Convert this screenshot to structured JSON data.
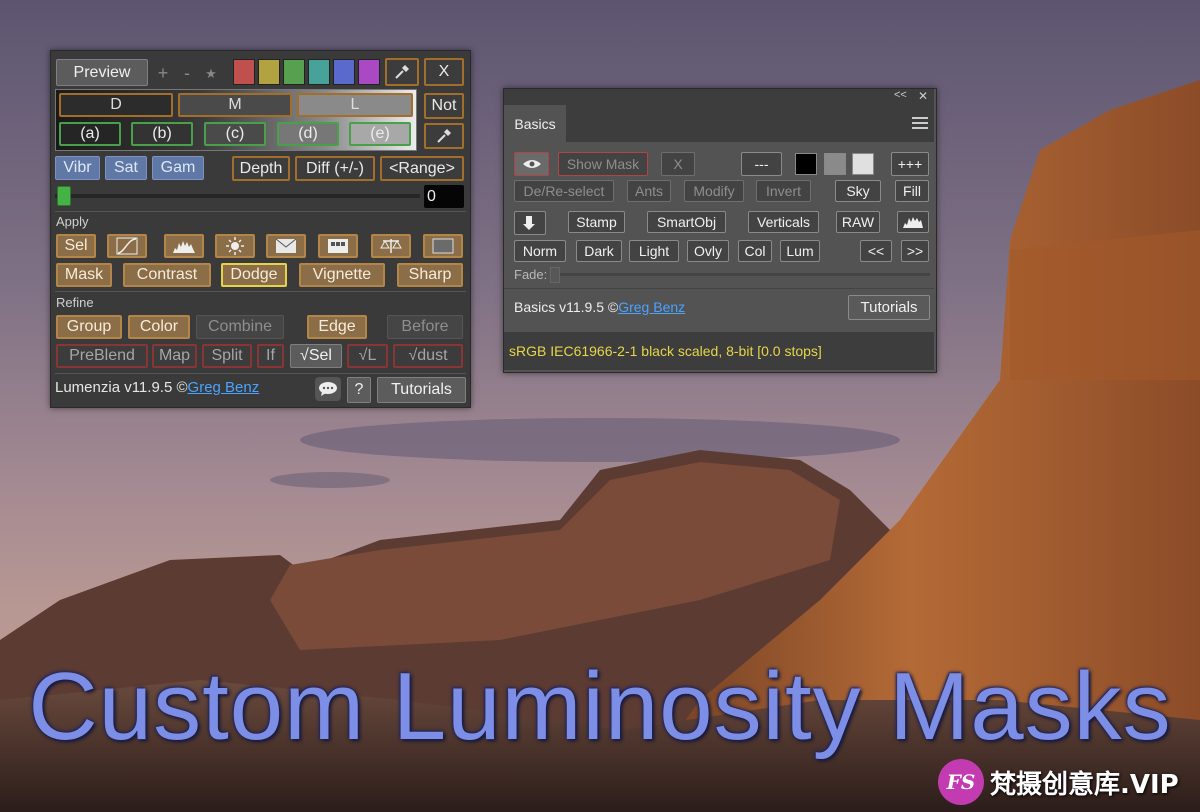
{
  "lumenzia": {
    "preview_label": "Preview",
    "plus": "+",
    "minus": "-",
    "star": "★",
    "close_label": "X",
    "swatch_colors": [
      "#c0504d",
      "#b3a340",
      "#57a050",
      "#47a39a",
      "#5a6acc",
      "#a949c4"
    ],
    "zone_row1": [
      "D",
      "M",
      "L"
    ],
    "not_label": "Not",
    "zone_row2": [
      "(a)",
      "(b)",
      "(c)",
      "(d)",
      "(e)"
    ],
    "vibr": "Vibr",
    "sat": "Sat",
    "gam": "Gam",
    "depth": "Depth",
    "diff": "Diff (+/-)",
    "range": "<Range>",
    "slider_value": "0",
    "apply_label": "Apply",
    "sel": "Sel",
    "mask": "Mask",
    "contrast": "Contrast",
    "dodge": "Dodge",
    "vignette": "Vignette",
    "sharp": "Sharp",
    "refine_label": "Refine",
    "group": "Group",
    "color": "Color",
    "combine": "Combine",
    "edge": "Edge",
    "before": "Before",
    "preblend": "PreBlend",
    "map": "Map",
    "split": "Split",
    "if": "If",
    "check_sel": "√Sel",
    "check_l": "√L",
    "check_dust": "√dust",
    "footer_version": "Lumenzia v11.9.5 ©",
    "footer_author": "Greg Benz",
    "help": "?",
    "tutorials": "Tutorials"
  },
  "basics": {
    "collapse": "<<",
    "close": "✕",
    "tab_label": "Basics",
    "show_mask": "Show Mask",
    "x": "X",
    "dashes": "---",
    "plus3": "+++",
    "deresel": "De/Re-select",
    "ants": "Ants",
    "modify": "Modify",
    "invert": "Invert",
    "sky": "Sky",
    "fill": "Fill",
    "stamp": "Stamp",
    "smartobj": "SmartObj",
    "verticals": "Verticals",
    "raw": "RAW",
    "norm": "Norm",
    "dark": "Dark",
    "light": "Light",
    "ovly": "Ovly",
    "col": "Col",
    "lum": "Lum",
    "prev": "<<",
    "next": ">>",
    "fade": "Fade:",
    "footer_version": "Basics v11.9.5 ©",
    "footer_author": "Greg Benz",
    "tutorials": "Tutorials",
    "status": "sRGB IEC61966-2-1 black scaled, 8-bit [0.0 stops]"
  },
  "title": "Custom Luminosity Masks",
  "watermark": {
    "logo_text": "FS",
    "text": "梵摄创意库.VIP"
  },
  "colors": {
    "title": "#7c8ee6",
    "status_text": "#e6d64a",
    "link": "#4aa3ff"
  }
}
